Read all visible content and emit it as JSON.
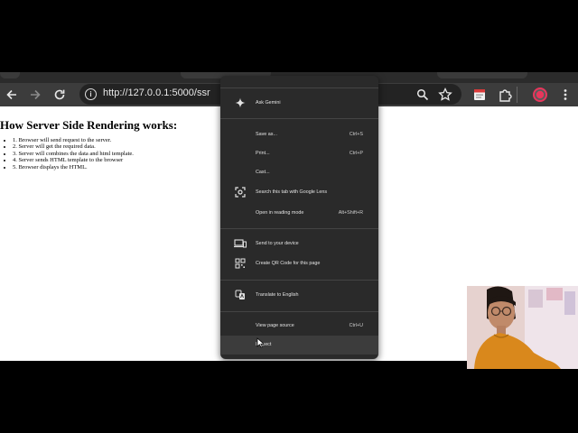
{
  "toolbar": {
    "url": "http://127.0.0.1:5000/ssr",
    "icons": [
      "back-icon",
      "forward-icon",
      "reload-icon",
      "info-icon",
      "zoom-icon",
      "bookmark-star-icon",
      "extension-icon",
      "puzzle-icon",
      "profile-icon",
      "kebab-menu-icon"
    ]
  },
  "page": {
    "heading": "How Server Side Rendering works:",
    "steps": [
      "1. Browser will send request to the server.",
      "2. Server will get the required data.",
      "3. Server will combines the data and html template.",
      "4. Server sends HTML template to the browser",
      "5. Browser displays the HTML."
    ]
  },
  "menu": {
    "items": [
      {
        "label": "Ask Gemini",
        "shortcut": ""
      },
      {
        "label": "Save as...",
        "shortcut": "Ctrl+S"
      },
      {
        "label": "Print...",
        "shortcut": "Ctrl+P"
      },
      {
        "label": "Cast...",
        "shortcut": ""
      },
      {
        "label": "Search this tab with Google Lens",
        "shortcut": ""
      },
      {
        "label": "Open in reading mode",
        "shortcut": "Alt+Shift+R"
      },
      {
        "label": "Send to your device",
        "shortcut": ""
      },
      {
        "label": "Create QR Code for this page",
        "shortcut": ""
      },
      {
        "label": "Translate to English",
        "shortcut": ""
      },
      {
        "label": "View page source",
        "shortcut": "Ctrl+U"
      },
      {
        "label": "Inspect",
        "shortcut": ""
      }
    ]
  },
  "colors": {
    "menu_bg": "#2a2a2a",
    "toolbar_bg": "#3c3c3c",
    "omnibox_bg": "#232323",
    "profile_ring": "#e8365c",
    "webcam_shirt": "#d9881c"
  }
}
